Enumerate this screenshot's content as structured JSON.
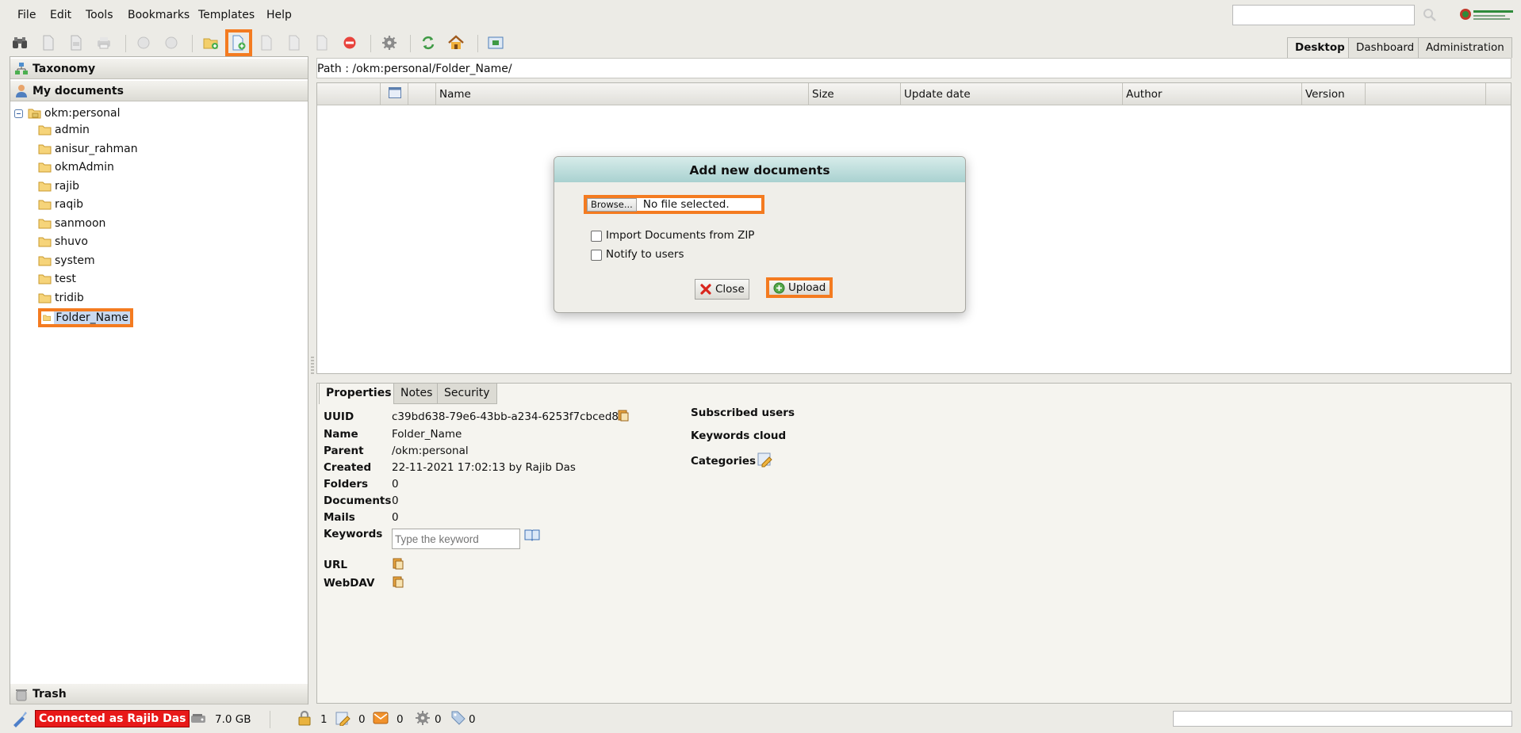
{
  "menu": [
    "File",
    "Edit",
    "Tools",
    "Bookmarks",
    "Templates",
    "Help"
  ],
  "search": {
    "placeholder": ""
  },
  "top_tabs": [
    "Desktop",
    "Dashboard",
    "Administration"
  ],
  "active_top_tab": "Desktop",
  "left": {
    "taxonomy": "Taxonomy",
    "my_documents": "My documents",
    "trash": "Trash",
    "root": "okm:personal",
    "folders": [
      "admin",
      "anisur_rahman",
      "okmAdmin",
      "rajib",
      "raqib",
      "sanmoon",
      "shuvo",
      "system",
      "test",
      "tridib",
      "Folder_Name"
    ],
    "selected_folder": "Folder_Name"
  },
  "path": {
    "label": "Path :",
    "value": "/okm:personal/Folder_Name/"
  },
  "grid": {
    "columns": [
      "Name",
      "Size",
      "Update date",
      "Author",
      "Version"
    ]
  },
  "dialog": {
    "title": "Add new documents",
    "browse_label": "Browse...",
    "file_status": "No file selected.",
    "import_zip_label": "Import Documents from ZIP",
    "notify_label": "Notify to users",
    "close_label": "Close",
    "upload_label": "Upload"
  },
  "properties": {
    "tabs": [
      "Properties",
      "Notes",
      "Security"
    ],
    "labels": {
      "uuid": "UUID",
      "name": "Name",
      "parent": "Parent",
      "created": "Created",
      "folders": "Folders",
      "documents": "Documents",
      "mails": "Mails",
      "keywords": "Keywords",
      "url": "URL",
      "webdav": "WebDAV"
    },
    "uuid": "c39bd638-79e6-43bb-a234-6253f7cbced8",
    "name": "Folder_Name",
    "parent": "/okm:personal",
    "created": "22-11-2021 17:02:13 by Rajib Das",
    "folders": "0",
    "documents": "0",
    "mails": "0",
    "keyword_placeholder": "Type the keyword",
    "subscribed_users": "Subscribed users",
    "keywords_cloud": "Keywords cloud",
    "categories": "Categories"
  },
  "status": {
    "connected": "Connected as Rajib Das",
    "storage": "7.0 GB",
    "locked": "1",
    "checkout": "0",
    "mails": "0",
    "workflows": "0",
    "tags": "0"
  },
  "colors": {
    "highlight": "#f47b20",
    "connected_bg": "#e81919",
    "dialog_header": "#a9d1d0"
  }
}
